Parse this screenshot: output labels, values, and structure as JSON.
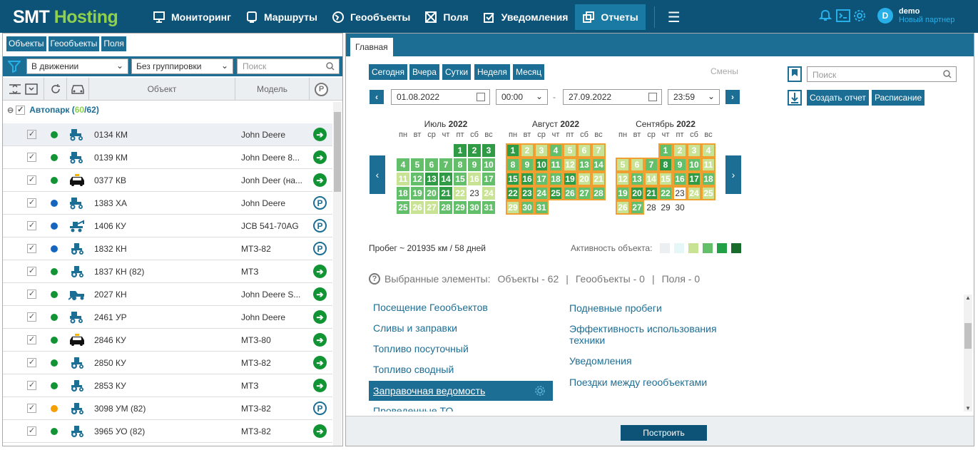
{
  "header": {
    "logo_a": "SMT",
    "logo_b": "Hosting",
    "nav": [
      {
        "label": "Мониторинг",
        "icon": "monitor-icon"
      },
      {
        "label": "Маршруты",
        "icon": "route-icon"
      },
      {
        "label": "Геообъекты",
        "icon": "geo-icon"
      },
      {
        "label": "Поля",
        "icon": "fields-icon"
      },
      {
        "label": "Уведомления",
        "icon": "notification-icon"
      },
      {
        "label": "Отчеты",
        "icon": "reports-icon",
        "active": true
      }
    ],
    "user_initial": "D",
    "user_name": "demo",
    "user_partner": "Новый партнер"
  },
  "left": {
    "tabs": [
      "Объекты",
      "Геообъекты",
      "Поля"
    ],
    "filter_motion": "В движении",
    "filter_group": "Без группировки",
    "search_placeholder": "Поиск",
    "col_object": "Объект",
    "col_model": "Модель",
    "group_name": "Автопарк (",
    "group_active": "60",
    "group_sep": "/",
    "group_total": "62",
    "group_close": ")",
    "rows": [
      {
        "obj": "0134 КМ",
        "model": "John Deere",
        "dot": "#109434",
        "veh": "tractor",
        "st": "go"
      },
      {
        "obj": "0139 КМ",
        "model": "John Deere 8...",
        "dot": "#109434",
        "veh": "tractor",
        "st": "go"
      },
      {
        "obj": "0377 КВ",
        "model": "Jonh Deer (на...",
        "dot": "#109434",
        "veh": "taxi",
        "st": "go"
      },
      {
        "obj": "1383 ХА",
        "model": "John Deere",
        "dot": "#1565c0",
        "veh": "tractor",
        "st": "park"
      },
      {
        "obj": "1406 КУ",
        "model": "JCB 541-70AG",
        "dot": "#1565c0",
        "veh": "loader",
        "st": "park"
      },
      {
        "obj": "1832 КН",
        "model": "МТЗ-82",
        "dot": "#1565c0",
        "veh": "tractor2",
        "st": "park"
      },
      {
        "obj": "1837 КН (82)",
        "model": "МТЗ",
        "dot": "#109434",
        "veh": "tractor2",
        "st": "go"
      },
      {
        "obj": "2027 КН",
        "model": "John Deere S...",
        "dot": "#109434",
        "veh": "harvester",
        "st": "go"
      },
      {
        "obj": "2461 УР",
        "model": "John Deere",
        "dot": "#109434",
        "veh": "tractor",
        "st": "go"
      },
      {
        "obj": "2846 КУ",
        "model": "МТЗ-80",
        "dot": "#109434",
        "veh": "taxi",
        "st": "go"
      },
      {
        "obj": "2850 КУ",
        "model": "МТЗ-82",
        "dot": "#109434",
        "veh": "tractor2",
        "st": "go"
      },
      {
        "obj": "2853 КУ",
        "model": "МТЗ",
        "dot": "#109434",
        "veh": "tractor2",
        "st": "go"
      },
      {
        "obj": "3098 УМ (82)",
        "model": "МТЗ-82",
        "dot": "#f5a000",
        "veh": "tractor2",
        "st": "park"
      },
      {
        "obj": "3965 УО (82)",
        "model": "МТЗ-82",
        "dot": "#109434",
        "veh": "tractor2",
        "st": "go"
      }
    ]
  },
  "right": {
    "tab": "Главная",
    "periods": [
      "Сегодня",
      "Вчера",
      "Сутки",
      "Неделя",
      "Месяц"
    ],
    "shifts": "Смены",
    "date_from": "01.08.2022",
    "time_from": "00:00",
    "dash": "-",
    "date_to": "27.09.2022",
    "time_to": "23:59",
    "weekdays": [
      "пн",
      "вт",
      "ср",
      "чт",
      "пт",
      "сб",
      "вс"
    ],
    "months": [
      {
        "name": "Июль",
        "year": "2022",
        "offset": 4,
        "days": [
          2,
          3,
          3,
          0,
          0,
          0,
          0,
          0,
          0,
          0,
          0,
          0,
          0,
          0,
          0,
          0,
          0,
          0,
          0,
          0,
          0,
          0,
          0,
          0,
          0,
          0,
          0,
          0,
          0,
          0,
          0
        ],
        "levels": [
          3,
          3,
          3,
          2,
          2,
          2,
          2,
          2,
          2,
          2,
          1,
          2,
          3,
          3,
          2,
          1,
          2,
          2,
          2,
          2,
          3,
          1,
          0,
          1,
          2,
          1,
          1,
          2,
          2,
          2,
          2
        ]
      },
      {
        "name": "Август",
        "year": "2022",
        "offset": 0,
        "levels": [
          3,
          1,
          1,
          2,
          1,
          1,
          1,
          2,
          2,
          3,
          2,
          1,
          2,
          2,
          3,
          3,
          2,
          2,
          3,
          1,
          1,
          3,
          3,
          2,
          3,
          2,
          2,
          2,
          1,
          2,
          2
        ]
      },
      {
        "name": "Сентябрь",
        "year": "2022",
        "offset": 3,
        "levels": [
          2,
          1,
          1,
          1,
          1,
          1,
          2,
          3,
          2,
          2,
          1,
          1,
          2,
          1,
          1,
          2,
          3,
          2,
          2,
          3,
          3,
          2,
          0,
          1,
          1,
          1,
          2,
          0,
          0,
          0
        ]
      }
    ],
    "probeg": "Пробег ~ 201935 км / 58 дней",
    "activity": "Активность объекта:",
    "legend_colors": [
      "#eceff2",
      "#e6f7f7",
      "#c9e394",
      "#63bf6a",
      "#22a045",
      "#176b2b"
    ],
    "selected": "Выбранные элементы:",
    "sel_objects": "Объекты - 62",
    "sel_sep1": "|",
    "sel_geo": "Геообъекты - 0",
    "sel_sep2": "|",
    "sel_fields": "Поля - 0",
    "reports_left": [
      "Посещение Геообъектов",
      "Сливы и заправки",
      "Топливо посуточный",
      "Топливо сводный",
      "Заправочная ведомость",
      "Проведенные ТО"
    ],
    "reports_right": [
      "Подневные пробеги",
      "Эффективность использования техники",
      "Уведомления",
      "Поездки между геообъектами"
    ],
    "search_placeholder": "Поиск",
    "create_report": "Создать отчет",
    "schedule": "Расписание",
    "build": "Построить"
  }
}
